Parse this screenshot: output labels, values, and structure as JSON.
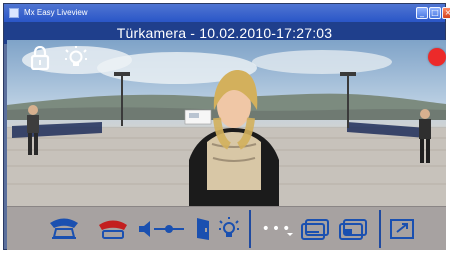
{
  "window": {
    "title": "Mx Easy Liveview",
    "controls": {
      "minimize": "_",
      "maximize": "□",
      "close": "×"
    }
  },
  "caption": {
    "text": "Türkamera - 10.02.2010-17:27:03"
  },
  "toolbar": {
    "icons": [
      "phone-pickup-icon",
      "phone-hangup-icon",
      "speaker-volume-icon",
      "door-open-icon",
      "light-icon",
      "more-icon",
      "camera-view-icon-1",
      "camera-view-icon-2",
      "window-toggle-icon"
    ],
    "more_text": "•••",
    "volume_level": 0.5
  },
  "status": {
    "recording_indicator_color": "#ec2a2a"
  }
}
